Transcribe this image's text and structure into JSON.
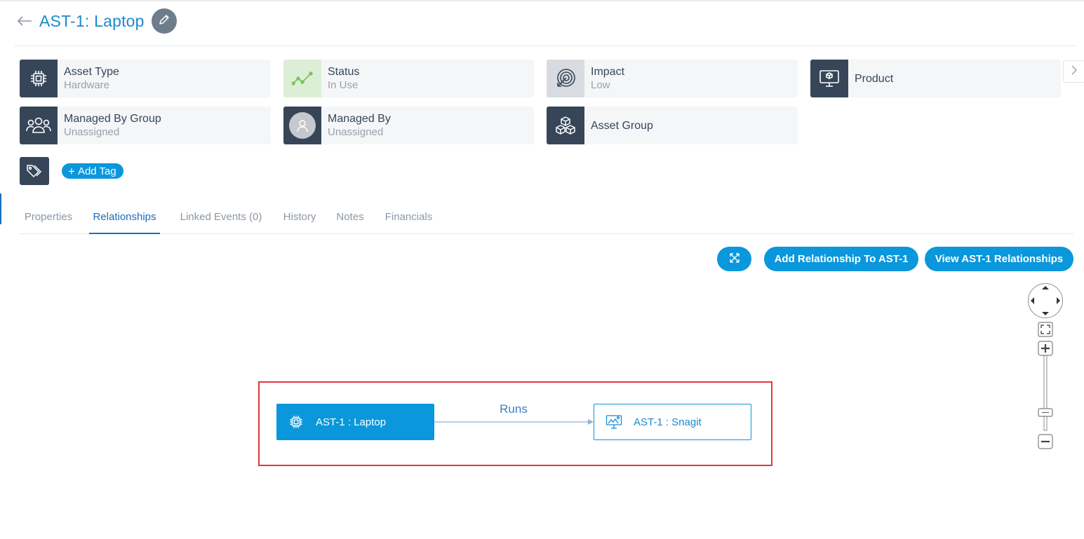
{
  "header": {
    "title": "AST-1: Laptop",
    "back_icon": "back-arrow-icon",
    "edit_icon": "pencil-icon"
  },
  "cards": [
    {
      "label": "Asset Type",
      "value": "Hardware",
      "icon": "chip-icon"
    },
    {
      "label": "Status",
      "value": "In Use",
      "icon": "trend-line-icon"
    },
    {
      "label": "Impact",
      "value": "Low",
      "icon": "target-icon"
    },
    {
      "label": "Product",
      "value": "",
      "icon": "monitor-box-icon"
    },
    {
      "label": "Managed By Group",
      "value": "Unassigned",
      "icon": "group-icon"
    },
    {
      "label": "Managed By",
      "value": "Unassigned",
      "icon": "avatar-icon"
    },
    {
      "label": "Asset Group",
      "value": "",
      "icon": "cubes-icon"
    }
  ],
  "tags": {
    "add_label": "Add Tag",
    "add_symbol": "+"
  },
  "tabs": [
    {
      "label": "Properties",
      "active": false
    },
    {
      "label": "Relationships",
      "active": true
    },
    {
      "label": "Linked Events (0)",
      "active": false
    },
    {
      "label": "History",
      "active": false
    },
    {
      "label": "Notes",
      "active": false
    },
    {
      "label": "Financials",
      "active": false
    }
  ],
  "toolbar": {
    "expand_icon": "expand-arrows-icon",
    "add_relationship_label": "Add Relationship To AST-1",
    "view_relationships_label": "View AST-1 Relationships"
  },
  "graph": {
    "source_node": "AST-1 : Laptop",
    "target_node": "AST-1 : Snagit",
    "edge_label": "Runs"
  },
  "colors": {
    "primary": "#0a97dc",
    "title": "#1a8ad0",
    "dark_icon_bg": "#364658",
    "highlight": "#e0393e",
    "status_bg": "#dcefd6",
    "status_line": "#7cc35a"
  }
}
